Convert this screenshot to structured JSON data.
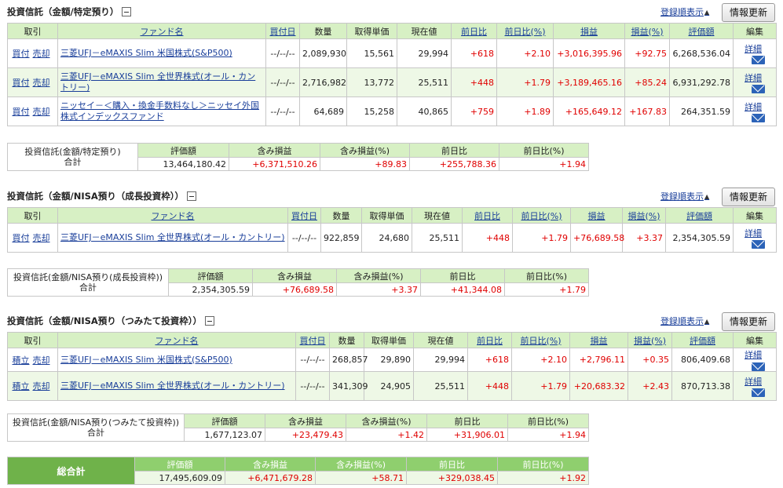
{
  "ui": {
    "sort_label": "登録順表示",
    "refresh_label": "情報更新",
    "buy_label": "買付",
    "sell_label": "売却",
    "tsumitate_label": "積立",
    "detail_label": "詳細"
  },
  "main_headers": [
    "取引",
    "ファンド名",
    "買付日",
    "数量",
    "取得単価",
    "現在値",
    "前日比",
    "前日比(%)",
    "損益",
    "損益(%)",
    "評価額",
    "編集"
  ],
  "sum_headers": [
    "評価額",
    "含み損益",
    "含み損益(%)",
    "前日比",
    "前日比(%)"
  ],
  "sections": [
    {
      "title": "投資信託（金額/特定預り）",
      "rows": [
        {
          "fund": "三菱UFJ－eMAXIS Slim 米国株式(S&P500)",
          "date": "--/--/--",
          "qty": "2,089,930",
          "cost": "15,561",
          "price": "29,994",
          "chg": "+618",
          "chg_pct": "+2.10",
          "pl": "+3,016,395.96",
          "pl_pct": "+92.75",
          "value": "6,268,536.04"
        },
        {
          "fund": "三菱UFJ－eMAXIS Slim 全世界株式(オール・カントリー)",
          "date": "--/--/--",
          "qty": "2,716,982",
          "cost": "13,772",
          "price": "25,511",
          "chg": "+448",
          "chg_pct": "+1.79",
          "pl": "+3,189,465.16",
          "pl_pct": "+85.24",
          "value": "6,931,292.78"
        },
        {
          "fund": "ニッセイ－＜購入・換金手数料なし＞ニッセイ外国株式インデックスファンド",
          "date": "--/--/--",
          "qty": "64,689",
          "cost": "15,258",
          "price": "40,865",
          "chg": "+759",
          "chg_pct": "+1.89",
          "pl": "+165,649.12",
          "pl_pct": "+167.83",
          "value": "264,351.59"
        }
      ],
      "summary": {
        "label": "投資信託(金額/特定預り)\n合計",
        "value": "13,464,180.42",
        "unrealized": "+6,371,510.26",
        "unrealized_pct": "+89.83",
        "chg": "+255,788.36",
        "chg_pct": "+1.94"
      }
    },
    {
      "title": "投資信託（金額/NISA預り（成長投資枠））",
      "rows": [
        {
          "fund": "三菱UFJ－eMAXIS Slim 全世界株式(オール・カントリー)",
          "date": "--/--/--",
          "qty": "922,859",
          "cost": "24,680",
          "price": "25,511",
          "chg": "+448",
          "chg_pct": "+1.79",
          "pl": "+76,689.58",
          "pl_pct": "+3.37",
          "value": "2,354,305.59"
        }
      ],
      "summary": {
        "label": "投資信託(金額/NISA預り(成長投資枠))\n合計",
        "value": "2,354,305.59",
        "unrealized": "+76,689.58",
        "unrealized_pct": "+3.37",
        "chg": "+41,344.08",
        "chg_pct": "+1.79"
      }
    },
    {
      "title": "投資信託（金額/NISA預り（つみたて投資枠））",
      "rows": [
        {
          "fund": "三菱UFJ－eMAXIS Slim 米国株式(S&P500)",
          "date": "--/--/--",
          "qty": "268,857",
          "cost": "29,890",
          "price": "29,994",
          "chg": "+618",
          "chg_pct": "+2.10",
          "pl": "+2,796.11",
          "pl_pct": "+0.35",
          "value": "806,409.68"
        },
        {
          "fund": "三菱UFJ－eMAXIS Slim 全世界株式(オール・カントリー)",
          "date": "--/--/--",
          "qty": "341,309",
          "cost": "24,905",
          "price": "25,511",
          "chg": "+448",
          "chg_pct": "+1.79",
          "pl": "+20,683.32",
          "pl_pct": "+2.43",
          "value": "870,713.38"
        }
      ],
      "summary": {
        "label": "投資信託(金額/NISA預り(つみたて投資枠))\n合計",
        "value": "1,677,123.07",
        "unrealized": "+23,479.43",
        "unrealized_pct": "+1.42",
        "chg": "+31,906.01",
        "chg_pct": "+1.94"
      }
    }
  ],
  "grand_total": {
    "label": "総合計",
    "value": "17,495,609.09",
    "unrealized": "+6,471,679.28",
    "unrealized_pct": "+58.71",
    "chg": "+329,038.45",
    "chg_pct": "+1.92"
  },
  "colors": {
    "header_green": "#d7f0c4",
    "row_alt": "#eef8e6",
    "total_green": "#6fb24a",
    "positive_red": "#e00000",
    "link_blue": "#1a3f9a"
  },
  "icons": {
    "collapse": "minus-box-icon",
    "sort": "triangle-up-icon",
    "mail": "envelope-icon"
  }
}
